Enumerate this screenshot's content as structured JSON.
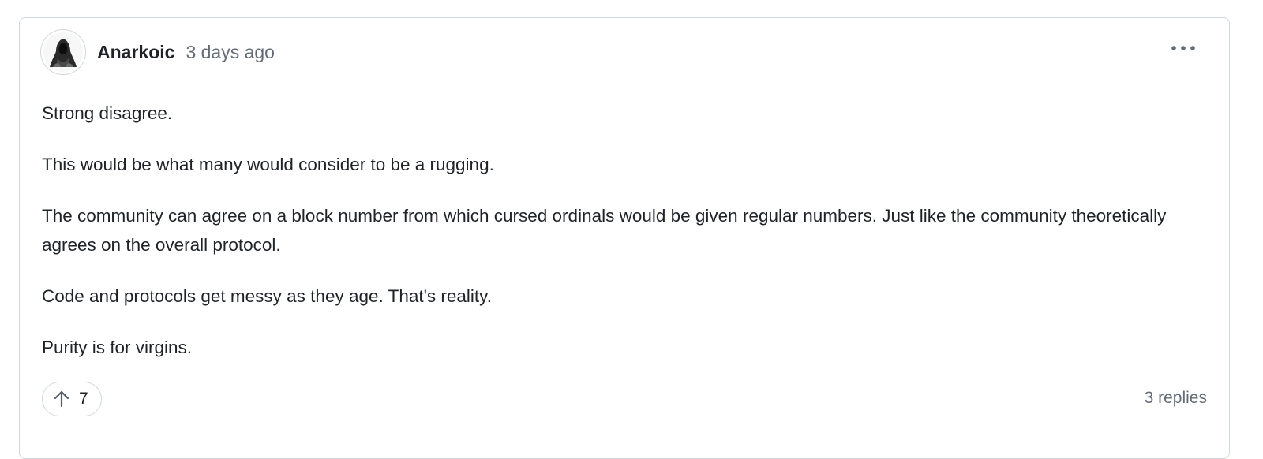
{
  "comment": {
    "author": "Anarkoic",
    "timestamp": "3 days ago",
    "paragraphs": [
      "Strong disagree.",
      "This would be what many would consider to be a rugging.",
      "The community can agree on a block number from which cursed ordinals would be given regular numbers. Just like the community theoretically agrees on the overall protocol.",
      "Code and protocols get messy as they age. That's reality.",
      "Purity is for virgins."
    ],
    "upvotes": "7",
    "replies": "3 replies"
  },
  "icons": {
    "avatar": "hooded-figure-avatar",
    "menu": "more-horizontal-icon",
    "upvote": "arrow-up-icon"
  },
  "colors": {
    "border": "#d0d7de",
    "muted_text": "#636c76",
    "text": "#1f2328"
  }
}
